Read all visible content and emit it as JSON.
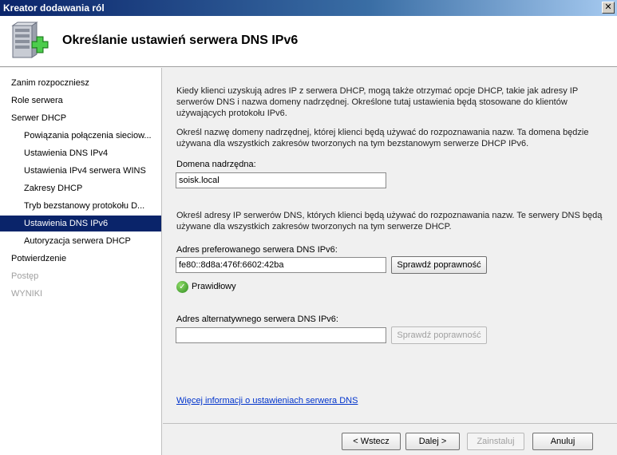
{
  "window": {
    "title": "Kreator dodawania ról",
    "close_label": "✕"
  },
  "header": {
    "title": "Określanie ustawień serwera DNS IPv6",
    "icon": "server-add-icon"
  },
  "sidebar": {
    "items": [
      {
        "label": "Zanim rozpoczniesz",
        "level": "top",
        "state": "normal"
      },
      {
        "label": "Role serwera",
        "level": "top",
        "state": "normal"
      },
      {
        "label": "Serwer DHCP",
        "level": "top",
        "state": "normal"
      },
      {
        "label": "Powiązania połączenia sieciow...",
        "level": "sub",
        "state": "normal"
      },
      {
        "label": "Ustawienia DNS IPv4",
        "level": "sub",
        "state": "normal"
      },
      {
        "label": "Ustawienia IPv4 serwera WINS",
        "level": "sub",
        "state": "normal"
      },
      {
        "label": "Zakresy DHCP",
        "level": "sub",
        "state": "normal"
      },
      {
        "label": "Tryb bezstanowy protokołu D...",
        "level": "sub",
        "state": "normal"
      },
      {
        "label": "Ustawienia DNS IPv6",
        "level": "sub",
        "state": "active"
      },
      {
        "label": "Autoryzacja serwera DHCP",
        "level": "sub",
        "state": "normal"
      },
      {
        "label": "Potwierdzenie",
        "level": "top",
        "state": "normal"
      },
      {
        "label": "Postęp",
        "level": "top",
        "state": "disabled"
      },
      {
        "label": "WYNIKI",
        "level": "top",
        "state": "disabled"
      }
    ]
  },
  "main": {
    "intro": "Kiedy klienci uzyskują adres IP z serwera DHCP, mogą także otrzymać opcje DHCP, takie jak adresy IP serwerów DNS i nazwa domeny nadrzędnej. Określone tutaj ustawienia będą stosowane do klientów używających protokołu IPv6.",
    "domain_intro": "Określ nazwę domeny nadrzędnej, której klienci będą używać do rozpoznawania nazw. Ta domena będzie używana dla wszystkich zakresów tworzonych na tym bezstanowym serwerze DHCP IPv6.",
    "domain_label": "Domena nadrzędna:",
    "domain_value": "soisk.local",
    "dns_intro": "Określ adresy IP serwerów DNS, których klienci będą używać do rozpoznawania nazw. Te serwery DNS będą używane dla wszystkich zakresów tworzonych na tym serwerze DHCP.",
    "preferred_label": "Adres preferowanego serwera DNS IPv6:",
    "preferred_value": "fe80::8d8a:476f:6602:42ba",
    "validate_label": "Sprawdź poprawność",
    "status_text": "Prawidłowy",
    "alternate_label": "Adres alternatywnego serwera DNS IPv6:",
    "alternate_value": "",
    "validate_alt_label": "Sprawdź poprawność",
    "info_link": "Więcej informacji o ustawieniach serwera DNS"
  },
  "footer": {
    "back": "< Wstecz",
    "next": "Dalej >",
    "install": "Zainstaluj",
    "cancel": "Anuluj"
  }
}
